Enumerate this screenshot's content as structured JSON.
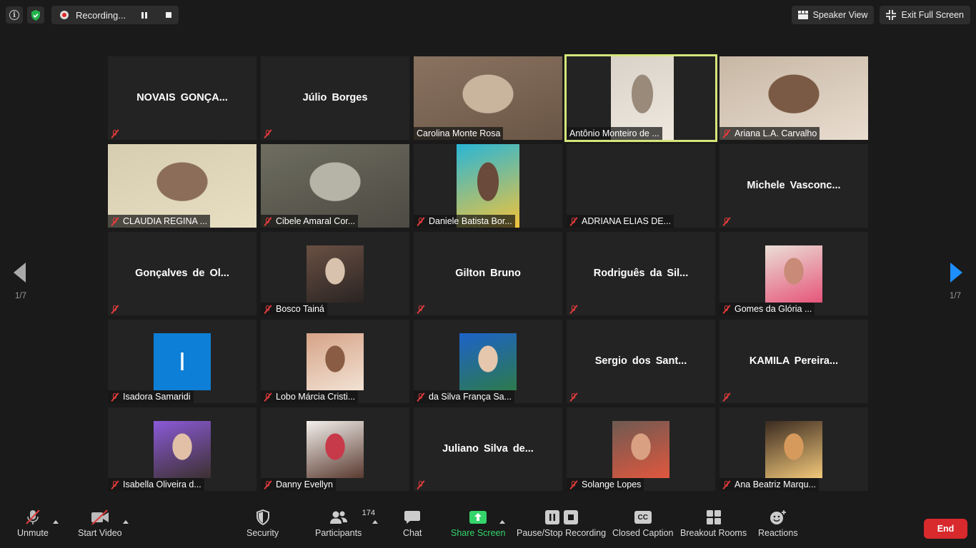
{
  "topbar": {
    "recording_label": "Recording...",
    "speaker_view_label": "Speaker View",
    "exit_fullscreen_label": "Exit Full Screen"
  },
  "pagination": {
    "left": "1/7",
    "right": "1/7"
  },
  "participants": [
    {
      "name": "NOVAIS GONÇA...",
      "type": "name",
      "label": ""
    },
    {
      "name": "Júlio Borges",
      "type": "name",
      "label": ""
    },
    {
      "name": "",
      "type": "video",
      "label": "Carolina Monte Rosa"
    },
    {
      "name": "",
      "type": "video",
      "label": "Antônio Monteiro de ..."
    },
    {
      "name": "",
      "type": "video",
      "label": "Ariana L.A. Carvalho"
    },
    {
      "name": "",
      "type": "video",
      "label": "CLAUDIA REGINA ..."
    },
    {
      "name": "",
      "type": "video",
      "label": "Cibele Amaral Cor..."
    },
    {
      "name": "",
      "type": "video",
      "label": "Daniele Batista Bor..."
    },
    {
      "name": "",
      "type": "empty",
      "label": "ADRIANA ELIAS DE..."
    },
    {
      "name": "Michele Vasconc...",
      "type": "name",
      "label": ""
    },
    {
      "name": "Gonçalves de Ol...",
      "type": "name",
      "label": ""
    },
    {
      "name": "",
      "type": "photo",
      "label": "Bosco Tainá"
    },
    {
      "name": "Gilton Bruno",
      "type": "name",
      "label": ""
    },
    {
      "name": "Rodriguês da Sil...",
      "type": "name",
      "label": ""
    },
    {
      "name": "",
      "type": "photo",
      "label": "Gomes da Glória ..."
    },
    {
      "name": "",
      "type": "initial",
      "initial": "I",
      "label": "Isadora Samaridi"
    },
    {
      "name": "",
      "type": "photo",
      "label": "Lobo Márcia Cristi..."
    },
    {
      "name": "",
      "type": "photo",
      "label": "da Silva França Sa..."
    },
    {
      "name": "Sergio dos Sant...",
      "type": "name",
      "label": ""
    },
    {
      "name": "KAMILA Pereira...",
      "type": "name",
      "label": ""
    },
    {
      "name": "",
      "type": "photo",
      "label": "Isabella Oliveira d..."
    },
    {
      "name": "",
      "type": "photo",
      "label": "Danny Evellyn"
    },
    {
      "name": "Juliano Silva de...",
      "type": "name",
      "label": ""
    },
    {
      "name": "",
      "type": "photo",
      "label": "Solange Lopes"
    },
    {
      "name": "",
      "type": "photo",
      "label": "Ana Beatriz Marqu..."
    }
  ],
  "toolbar": {
    "unmute": "Unmute",
    "start_video": "Start Video",
    "security": "Security",
    "participants": "Participants",
    "participant_count": "174",
    "chat": "Chat",
    "share_screen": "Share Screen",
    "pause_stop_recording": "Pause/Stop Recording",
    "closed_caption": "Closed Caption",
    "cc_badge": "CC",
    "breakout_rooms": "Breakout Rooms",
    "reactions": "Reactions",
    "end": "End"
  },
  "colors": {
    "background": "#1a1a1a",
    "tile": "#232323",
    "active_speaker": "#d6e57a",
    "mute_red": "#e03b3b",
    "share_green": "#35d46b",
    "end_red": "#d8292d",
    "next_arrow": "#1e8fff"
  }
}
